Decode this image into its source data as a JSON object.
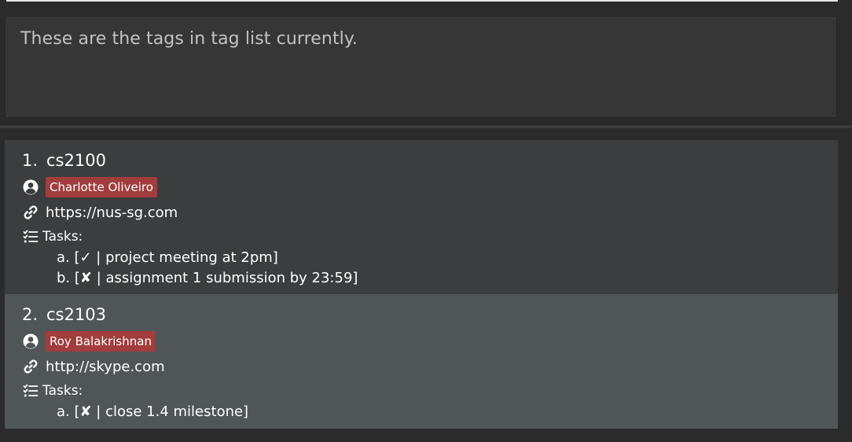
{
  "result_display": {
    "message": "These are the tags in tag list currently."
  },
  "tags": [
    {
      "index": "1.",
      "name": "cs2100",
      "person": "Charlotte Oliveiro",
      "link": "https://nus-sg.com",
      "tasks_label": "Tasks:",
      "tasks": [
        "a. [✓ | project meeting at 2pm]",
        "b. [✘ | assignment 1 submission by 23:59]"
      ]
    },
    {
      "index": "2.",
      "name": "cs2103",
      "person": "Roy Balakrishnan",
      "link": "http://skype.com",
      "tasks_label": "Tasks:",
      "tasks": [
        "a. [✘ | close 1.4 milestone]"
      ]
    }
  ],
  "icons": {
    "person": "user-circle-icon",
    "link": "link-icon",
    "tasks": "task-list-icon"
  },
  "colors": {
    "background": "#2b2b2b",
    "result_box": "#363636",
    "card_odd": "#3c3d3f",
    "card_even": "#505658",
    "person_tag": "#a13d3d"
  }
}
